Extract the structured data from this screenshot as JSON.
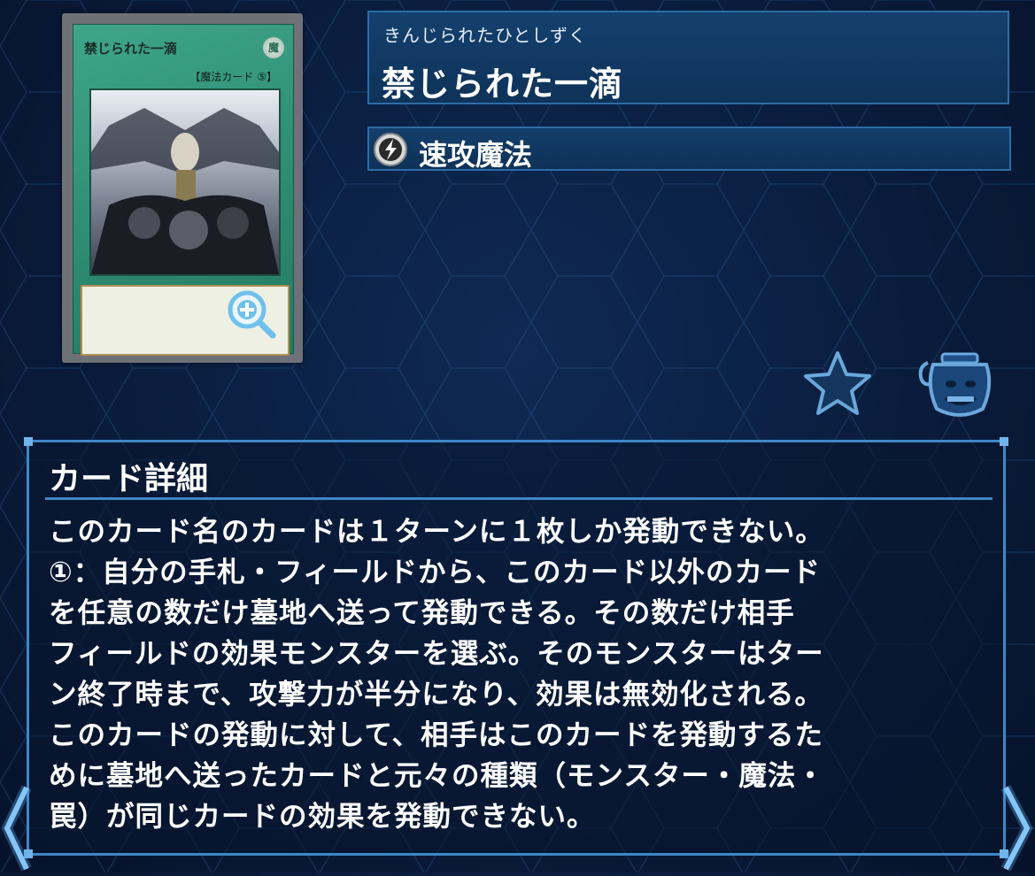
{
  "card": {
    "ruby": "きんじられたひとしずく",
    "name": "禁じられた一滴",
    "type_label": "速攻魔法",
    "image_name_text": "禁じられた一滴",
    "image_type_text": "【魔法カード ⑤】",
    "image_attribute": "魔"
  },
  "detail": {
    "heading": "カード詳細",
    "text": "このカード名のカードは１ターンに１枚しか発動できない。\n①：自分の手札・フィールドから、このカード以外のカード\nを任意の数だけ墓地へ送って発動できる。その数だけ相手\nフィールドの効果モンスターを選ぶ。そのモンスターはター\nン終了時まで、攻撃力が半分になり、効果は無効化される。\nこのカードの発動に対して、相手はこのカードを発動するた\nめに墓地へ送ったカードと元々の種類（モンスター・魔法・\n罠）が同じカードの効果を発動できない。"
  },
  "icons": {
    "zoom": "zoom-in-icon",
    "quick_play": "quick-play-spell-icon",
    "favorite": "star-icon",
    "pot": "pot-of-greed-icon",
    "nav_left": "chevron-left-icon",
    "nav_right": "chevron-right-icon"
  },
  "colors": {
    "accent": "#3f87c6",
    "panel": "#14406e",
    "card_frame": "#2c8a70"
  }
}
